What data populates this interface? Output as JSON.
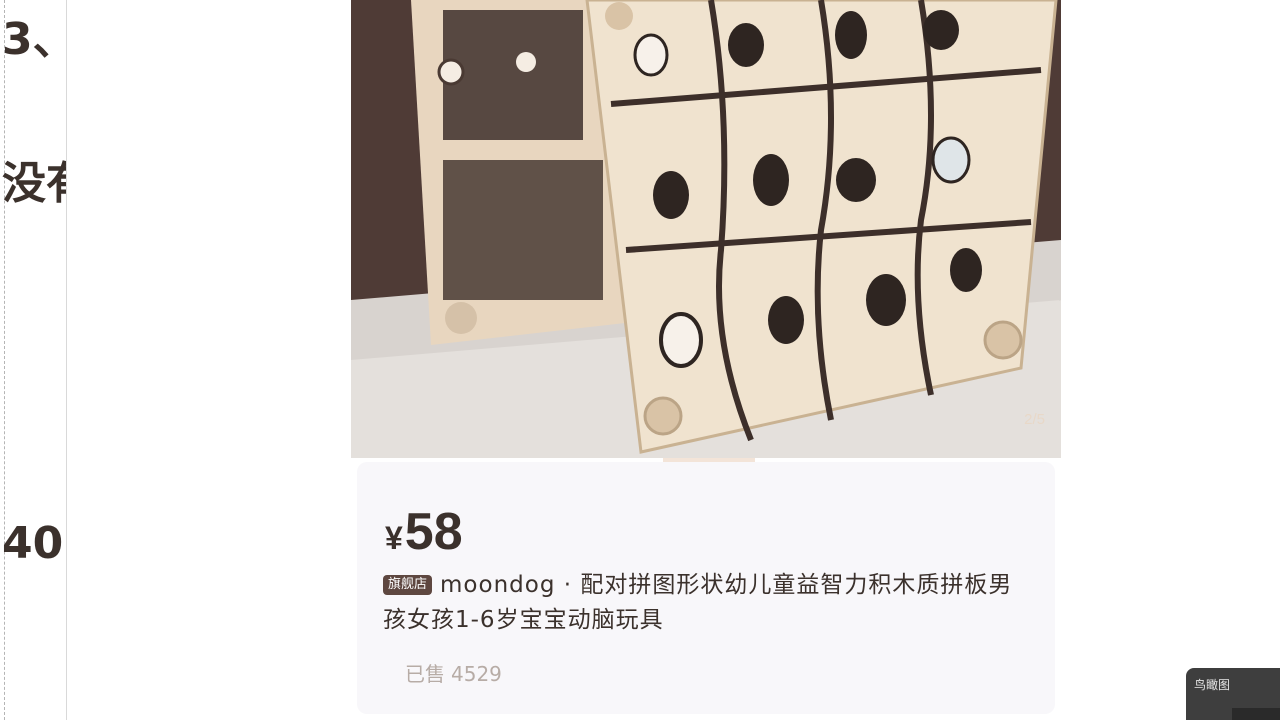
{
  "left_slide": {
    "line1": "3、",
    "line2": "没有",
    "line3": "40"
  },
  "product": {
    "image_alt": "wooden animal matching puzzle board",
    "page_indicator": "2/5",
    "price": {
      "currency": "¥",
      "amount": "58"
    },
    "store_badge": "旗舰店",
    "title": "moondog · 配对拼图形状幼儿童益智力积木质拼板男孩女孩1-6岁宝宝动脑玩具",
    "sold": {
      "label": "已售",
      "count": "4529"
    }
  },
  "floating_widget": {
    "label": "鸟瞰图"
  },
  "colors": {
    "brand_dark": "#3b312c",
    "badge_bg": "#5e4740",
    "photo_bg": "#4f3b36",
    "muted_text": "#b7aca6"
  }
}
